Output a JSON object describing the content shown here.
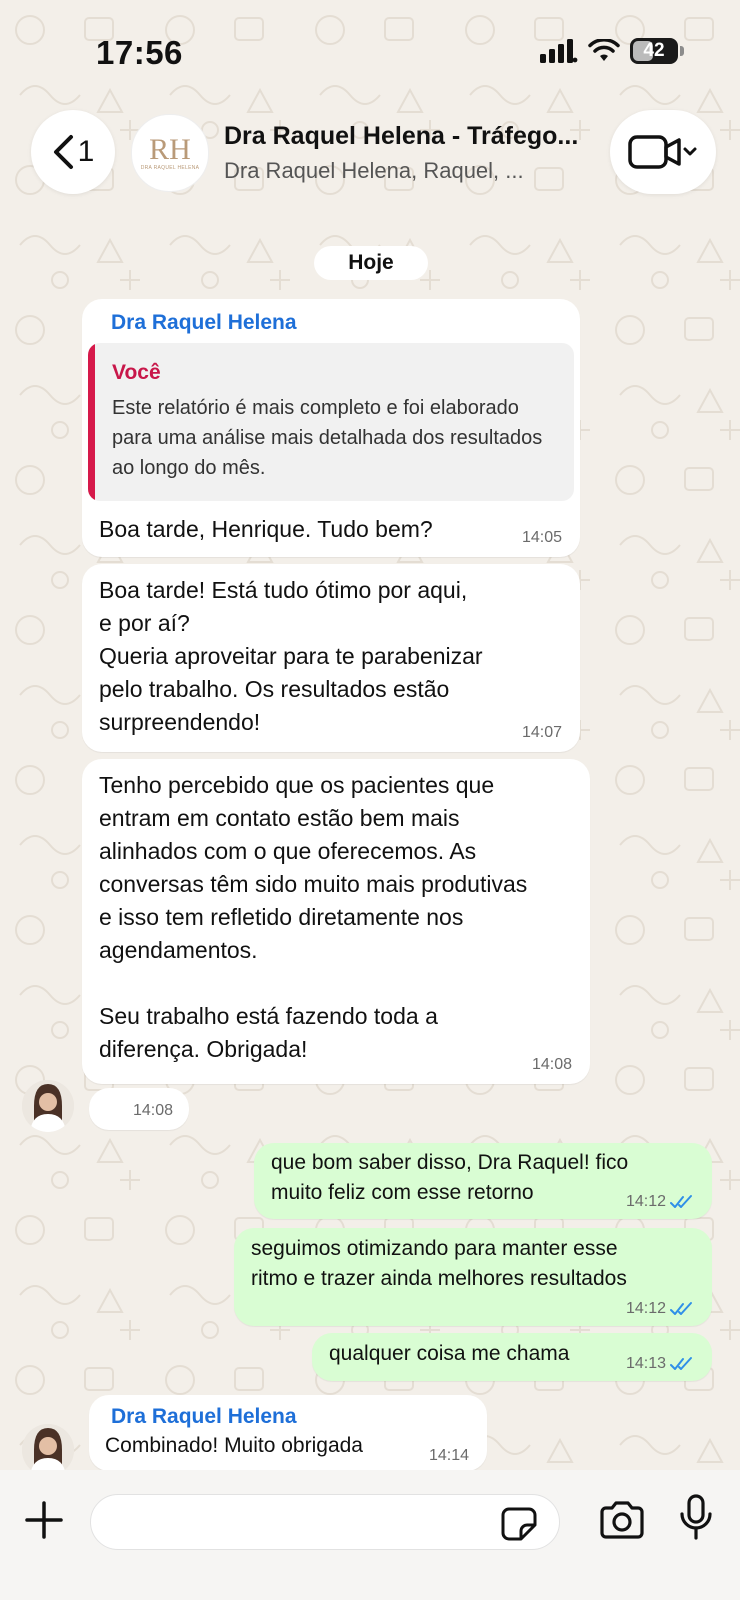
{
  "status_bar": {
    "time": "17:56",
    "battery_level": "42"
  },
  "header": {
    "back_count": "1",
    "title": "Dra Raquel Helena - Tráfego...",
    "subtitle": "Dra Raquel Helena, Raquel, ...",
    "group_avatar_monogram": "RH",
    "group_avatar_sub": "DRA RAQUEL HELENA"
  },
  "date_separator": "Hoje",
  "messages": [
    {
      "sender": "Dra Raquel Helena",
      "quote": {
        "sender": "Você",
        "text": "Este relatório é mais completo e foi elaborado para uma análise mais detalhada dos resultados ao longo do mês."
      },
      "text": "Boa tarde, Henrique. Tudo bem?",
      "time": "14:05"
    },
    {
      "text": "Boa tarde! Está tudo ótimo por aqui,\ne por aí?\nQueria aproveitar para te parabenizar\npelo trabalho. Os resultados estão\nsurpreendendo!",
      "time": "14:07"
    },
    {
      "text": "Tenho percebido que os pacientes que\nentram em contato estão bem mais\nalinhados com o que oferecemos. As\nconversas têm sido muito mais produtivas\ne isso tem refletido diretamente nos\nagendamentos.\n\nSeu trabalho está fazendo toda a\ndiferença. Obrigada!",
      "time": "14:08"
    },
    {
      "text": "",
      "time": "14:08"
    },
    {
      "text": "que bom saber disso, Dra Raquel! fico\nmuito feliz com esse retorno",
      "time": "14:12"
    },
    {
      "text": "seguimos otimizando para manter esse\nritmo e trazer ainda melhores resultados",
      "time": "14:12"
    },
    {
      "text": "qualquer coisa me chama",
      "time": "14:13"
    },
    {
      "sender": "Dra Raquel Helena",
      "text": "Combinado! Muito obrigada",
      "time": "14:14"
    }
  ],
  "composer": {
    "placeholder": ""
  },
  "colors": {
    "outgoing_bubble": "#d9fdd3",
    "incoming_bubble": "#ffffff",
    "sender_name": "#1e6fd8",
    "quote_accent": "#d6194a",
    "read_ticks": "#2f8fe8",
    "background": "#f3efe9"
  },
  "icons": [
    "back-chevron-icon",
    "video-call-icon",
    "signal-icon",
    "wifi-icon",
    "battery-icon",
    "read-ticks-icon",
    "plus-icon",
    "sticker-icon",
    "camera-icon",
    "microphone-icon"
  ]
}
